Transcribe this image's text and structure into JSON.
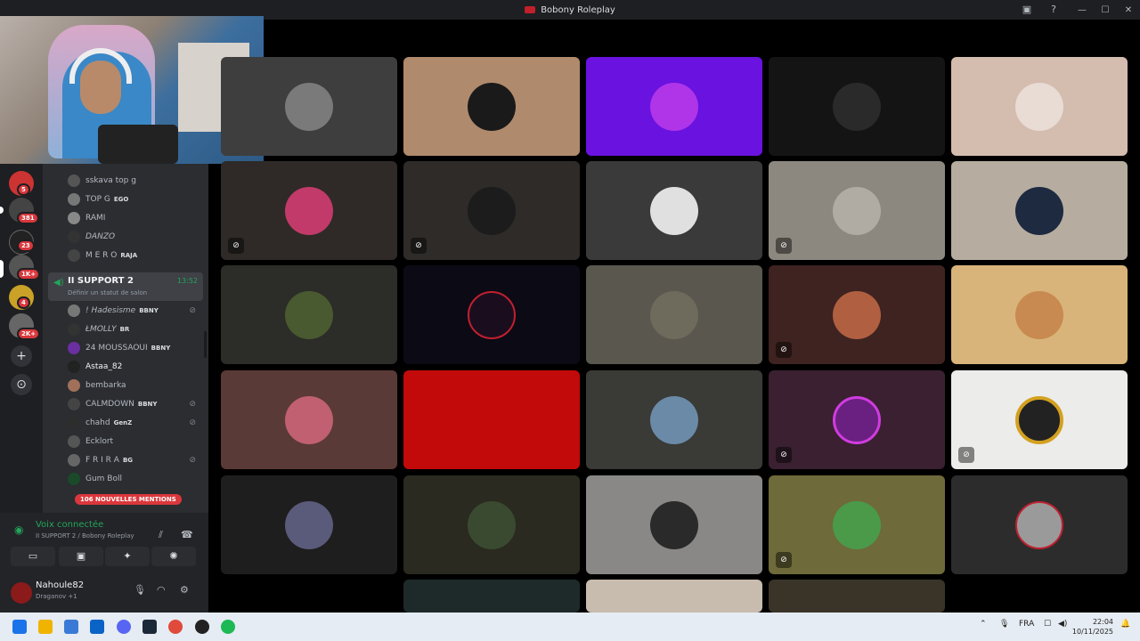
{
  "window": {
    "title": "Bobony Roleplay"
  },
  "server_badges": [
    {
      "value": "5"
    },
    {
      "value": "381"
    },
    {
      "value": "23"
    },
    {
      "value": "1K+"
    },
    {
      "value": "4"
    },
    {
      "value": "2K+"
    }
  ],
  "members_top": [
    {
      "name": "sskava top g",
      "tag": ""
    },
    {
      "name": "TOP G",
      "tag": "EGO"
    },
    {
      "name": "RAMI",
      "tag": ""
    },
    {
      "name": "DANZO",
      "tag": ""
    },
    {
      "name": "M E R O",
      "tag": "RAJA"
    }
  ],
  "voice_channel": {
    "name": "II SUPPORT 2",
    "time": "13:52",
    "status": "Définir un statut de salon"
  },
  "voice_members": [
    {
      "name": "! Hadesisme",
      "tag": "BBNY"
    },
    {
      "name": "ŁMOLLY",
      "tag": "BR"
    },
    {
      "name": "24 MOUSSAOUI",
      "tag": "BBNY"
    },
    {
      "name": "Astaa_82",
      "tag": ""
    },
    {
      "name": "bembarka",
      "tag": ""
    },
    {
      "name": "CALMDOWN",
      "tag": "BBNY"
    },
    {
      "name": "chahd",
      "tag": "GenZ"
    },
    {
      "name": "Ecklort",
      "tag": ""
    },
    {
      "name": "F R I R A",
      "tag": "BG"
    },
    {
      "name": "Gum Boll",
      "tag": ""
    }
  ],
  "mentions": "106 NOUVELLES MENTIONS",
  "voice_panel": {
    "connected": "Voix connectée",
    "channel": "II SUPPORT 2 / Bobony Roleplay"
  },
  "user": {
    "name": "Nahoule82",
    "status": "Draganov +1"
  },
  "taskbar": {
    "lang": "FRA",
    "time": "22:04",
    "date": "10/11/2025"
  },
  "colors": {
    "accent_green": "#23a559",
    "alert_red": "#da373c"
  }
}
